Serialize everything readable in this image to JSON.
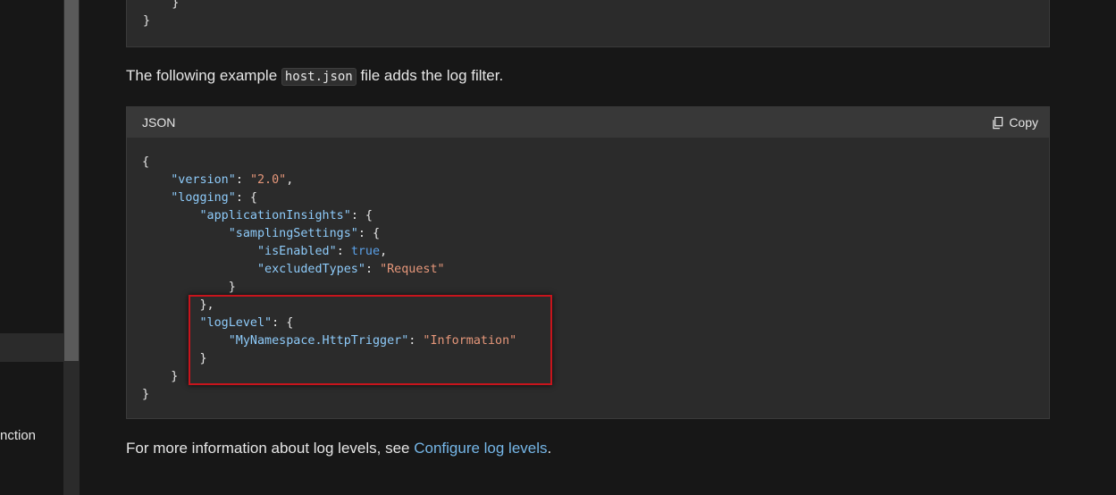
{
  "sidebar": {
    "partial_item_label": "nction"
  },
  "code_top": {
    "lines": [
      "    }",
      "}"
    ]
  },
  "paragraph1": {
    "before": "The following example ",
    "code": "host.json",
    "after": " file adds the log filter."
  },
  "code_block": {
    "language": "JSON",
    "copy_label": "Copy",
    "json": {
      "l1": "{",
      "version_key": "\"version\"",
      "version_val": "\"2.0\"",
      "logging_key": "\"logging\"",
      "appinsights_key": "\"applicationInsights\"",
      "sampling_key": "\"samplingSettings\"",
      "isenabled_key": "\"isEnabled\"",
      "isenabled_val": "true",
      "excluded_key": "\"excludedTypes\"",
      "excluded_val": "\"Request\"",
      "loglevel_key": "\"logLevel\"",
      "httptrigger_key": "\"MyNamespace.HttpTrigger\"",
      "httptrigger_val": "\"Information\""
    }
  },
  "paragraph2": {
    "before": "For more information about log levels, see ",
    "link": "Configure log levels",
    "after": "."
  },
  "colors": {
    "background": "#171717",
    "code_bg": "#2b2b2b",
    "link": "#75b6e7",
    "json_key": "#8ecbfa",
    "json_string": "#e6977a",
    "json_bool": "#5aa0e8",
    "highlight": "#c8141c"
  }
}
